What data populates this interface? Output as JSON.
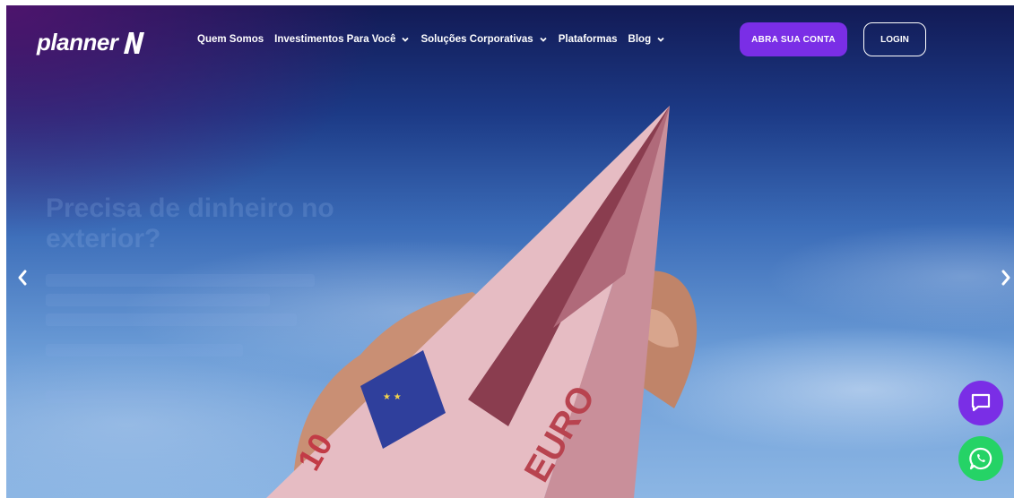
{
  "brand": {
    "logo_text": "planner",
    "logo_icon": "planner-n-logo-icon"
  },
  "nav": {
    "items": [
      {
        "label": "Quem Somos",
        "dropdown": false
      },
      {
        "label": "Investimentos Para Você",
        "dropdown": true
      },
      {
        "label": "Soluções Corporativas",
        "dropdown": true
      },
      {
        "label": "Plataformas",
        "dropdown": false
      },
      {
        "label": "Blog",
        "dropdown": true
      }
    ],
    "cta_label": "ABRA SUA CONTA",
    "login_label": "LOGIN"
  },
  "hero": {
    "heading": "Precisa de dinheiro no exterior?",
    "banknote_text": "EURO",
    "banknote_value": "10"
  },
  "carousel": {
    "prev_icon": "chevron-left-icon",
    "next_icon": "chevron-right-icon"
  },
  "floating": {
    "chat_icon": "chat-icon",
    "whatsapp_icon": "whatsapp-icon"
  },
  "colors": {
    "accent": "#7a2ee6",
    "whatsapp": "#25d366",
    "text_light": "#ffffff",
    "banknote": "#e7bcc2"
  }
}
